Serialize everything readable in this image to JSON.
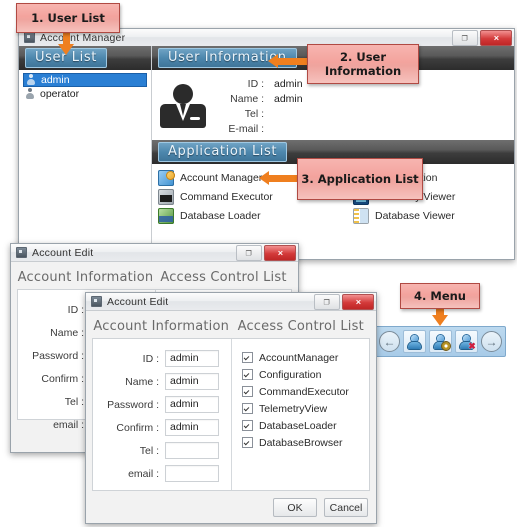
{
  "main_window": {
    "title": "Account Manager",
    "window_buttons": {
      "restore": "❐",
      "close": "✕"
    },
    "user_list": {
      "header": "User List",
      "items": [
        {
          "label": "admin",
          "selected": true
        },
        {
          "label": "operator",
          "selected": false
        }
      ]
    },
    "user_information": {
      "header": "User Information",
      "fields": [
        {
          "label": "ID :",
          "value": "admin"
        },
        {
          "label": "Name :",
          "value": "admin"
        },
        {
          "label": "Tel :",
          "value": ""
        },
        {
          "label": "E-mail :",
          "value": ""
        }
      ]
    },
    "application_list": {
      "header": "Application List",
      "left_column": [
        {
          "label": "Account Manager",
          "icon": "account-manager-icon"
        },
        {
          "label": "Command Executor",
          "icon": "command-executor-icon"
        },
        {
          "label": "Database Loader",
          "icon": "database-loader-icon"
        }
      ],
      "right_column": [
        {
          "label": "Configuration",
          "icon": "configuration-icon"
        },
        {
          "label": "Telemetry Viewer",
          "icon": "telemetry-viewer-icon"
        },
        {
          "label": "Database Viewer",
          "icon": "database-viewer-icon"
        }
      ]
    }
  },
  "dialog_back": {
    "title": "Account Edit",
    "window_buttons": {
      "restore": "❐",
      "close": "✕"
    },
    "tabs": [
      {
        "label": "Account Information"
      },
      {
        "label": "Access Control List"
      }
    ],
    "fields": [
      {
        "label": "ID :",
        "value": ""
      },
      {
        "label": "Name :",
        "value": ""
      },
      {
        "label": "Password :",
        "value": ""
      },
      {
        "label": "Confirm :",
        "value": ""
      },
      {
        "label": "Tel :",
        "value": ""
      },
      {
        "label": "email :",
        "value": ""
      }
    ]
  },
  "dialog_front": {
    "title": "Account Edit",
    "window_buttons": {
      "restore": "❐",
      "close": "✕"
    },
    "tabs": [
      {
        "label": "Account Information"
      },
      {
        "label": "Access Control List"
      }
    ],
    "fields": [
      {
        "label": "ID :",
        "value": "admin"
      },
      {
        "label": "Name :",
        "value": "admin"
      },
      {
        "label": "Password :",
        "value": "admin"
      },
      {
        "label": "Confirm :",
        "value": "admin"
      },
      {
        "label": "Tel :",
        "value": ""
      },
      {
        "label": "email :",
        "value": ""
      }
    ],
    "access_control_list": [
      {
        "label": "AccountManager",
        "checked": true
      },
      {
        "label": "Configuration",
        "checked": true
      },
      {
        "label": "CommandExecutor",
        "checked": true
      },
      {
        "label": "TelemetryView",
        "checked": true
      },
      {
        "label": "DatabaseLoader",
        "checked": true
      },
      {
        "label": "DatabaseBrowser",
        "checked": true
      }
    ],
    "buttons": {
      "ok": "OK",
      "cancel": "Cancel"
    }
  },
  "menu_toolbar": {
    "buttons": [
      {
        "name": "previous",
        "glyph": "←"
      },
      {
        "name": "add-user",
        "glyph": ""
      },
      {
        "name": "edit-user",
        "glyph": ""
      },
      {
        "name": "delete-user",
        "glyph": "✖"
      },
      {
        "name": "next",
        "glyph": "→"
      }
    ]
  },
  "callouts": [
    {
      "id": 1,
      "text": "1. User List"
    },
    {
      "id": 2,
      "text": "2. User Information"
    },
    {
      "id": 3,
      "text": "3. Application List"
    },
    {
      "id": 4,
      "text": "4. Menu"
    }
  ],
  "colors": {
    "callout_fill": "#f3a39d",
    "callout_border": "#b04a43",
    "arrow": "#ef7f1f",
    "header_blue": "#4d87ad",
    "selection_blue": "#2a7fd4",
    "toolbar_blue": "#a8cbe8"
  }
}
